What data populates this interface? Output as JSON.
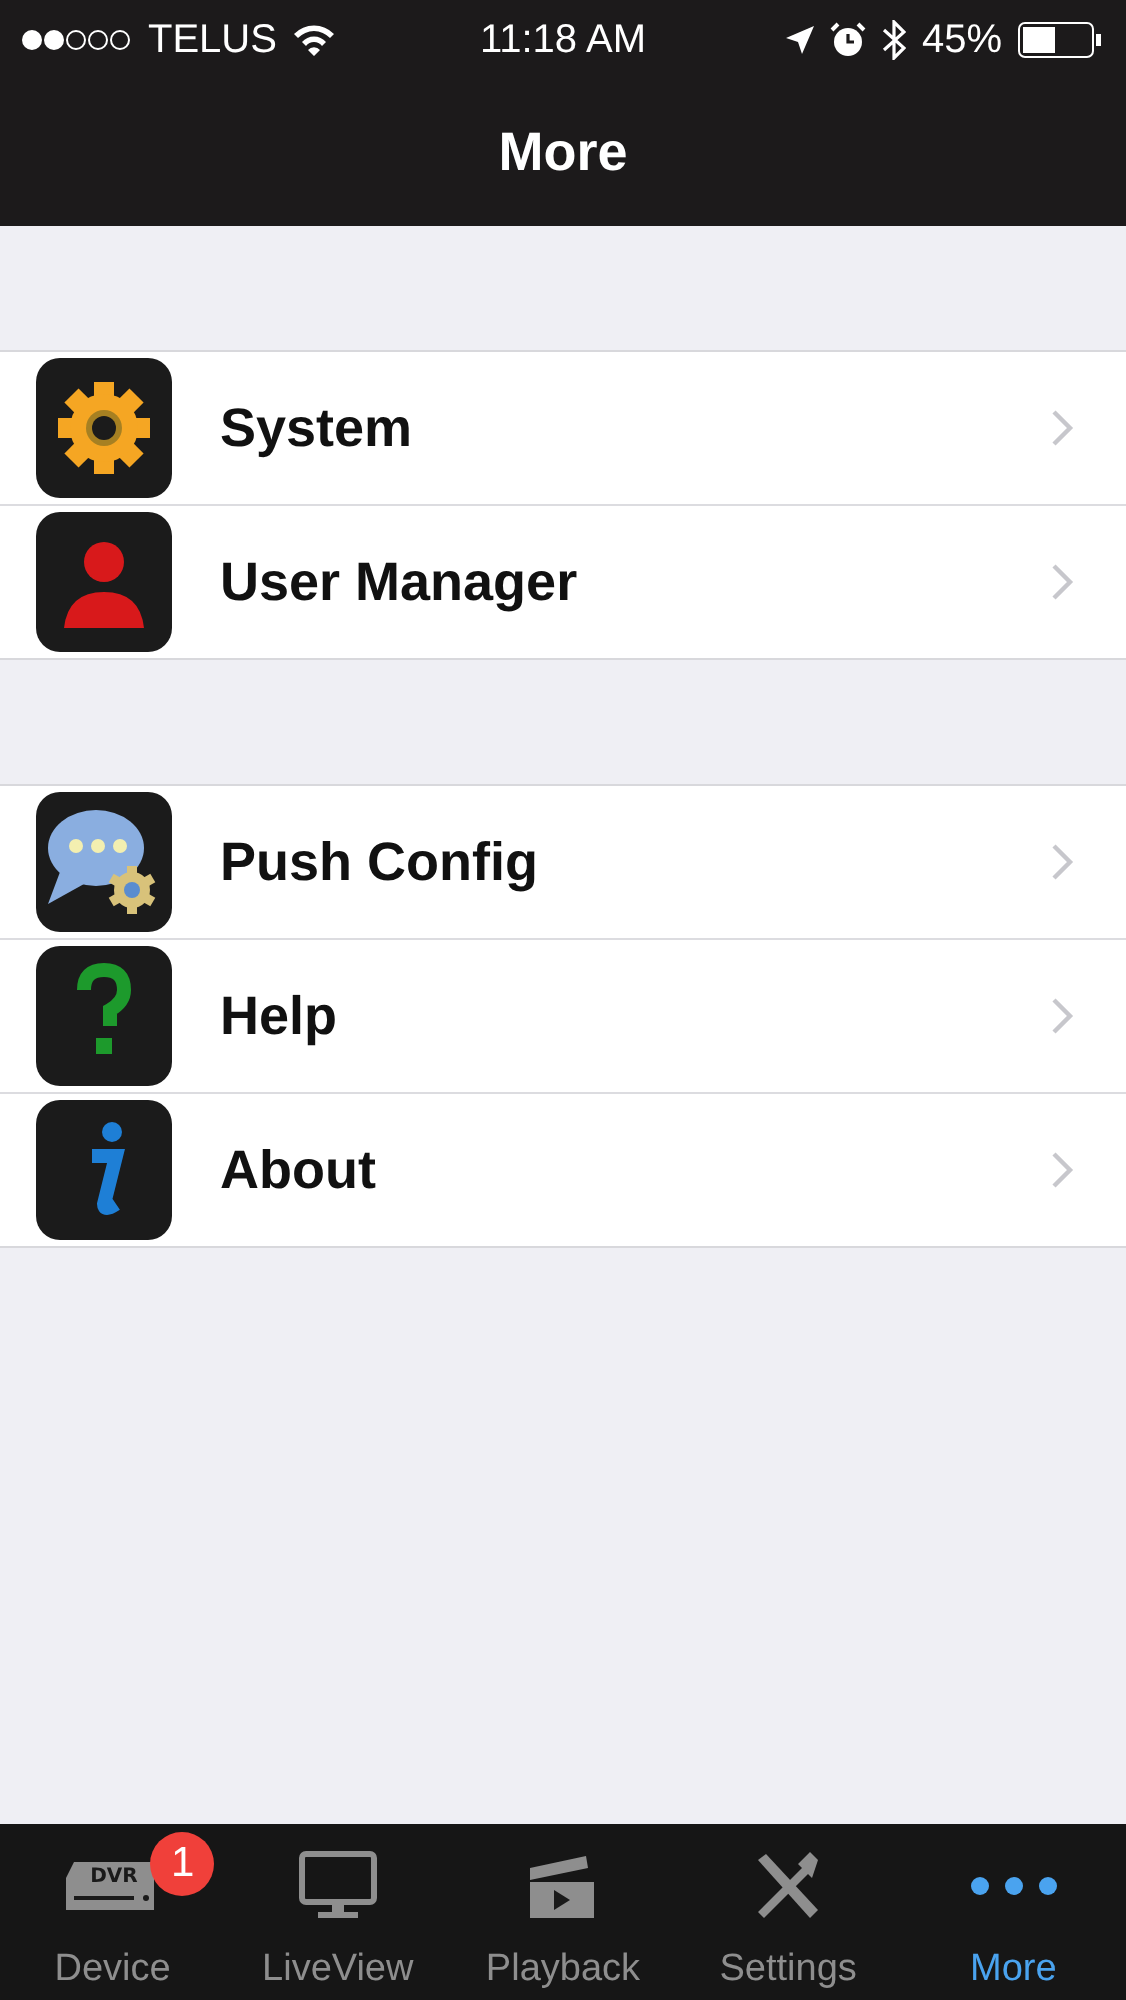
{
  "status_bar": {
    "carrier": "TELUS",
    "time": "11:18 AM",
    "battery": "45%"
  },
  "nav_bar": {
    "title": "More"
  },
  "sections": [
    {
      "items": [
        {
          "label": "System",
          "kind": "gear"
        },
        {
          "label": "User Manager",
          "kind": "user"
        }
      ]
    },
    {
      "items": [
        {
          "label": "Push Config",
          "kind": "chat"
        },
        {
          "label": "Help",
          "kind": "help"
        },
        {
          "label": "About",
          "kind": "info"
        }
      ]
    }
  ],
  "tab_bar": [
    {
      "label": "Device",
      "kind": "dvr",
      "icon_text": "DVR",
      "badge": "1",
      "selected": false
    },
    {
      "label": "LiveView",
      "kind": "monitor",
      "selected": false
    },
    {
      "label": "Playback",
      "kind": "clapper",
      "selected": false
    },
    {
      "label": "Settings",
      "kind": "tools",
      "selected": false
    },
    {
      "label": "More",
      "kind": "dots",
      "selected": true
    }
  ]
}
